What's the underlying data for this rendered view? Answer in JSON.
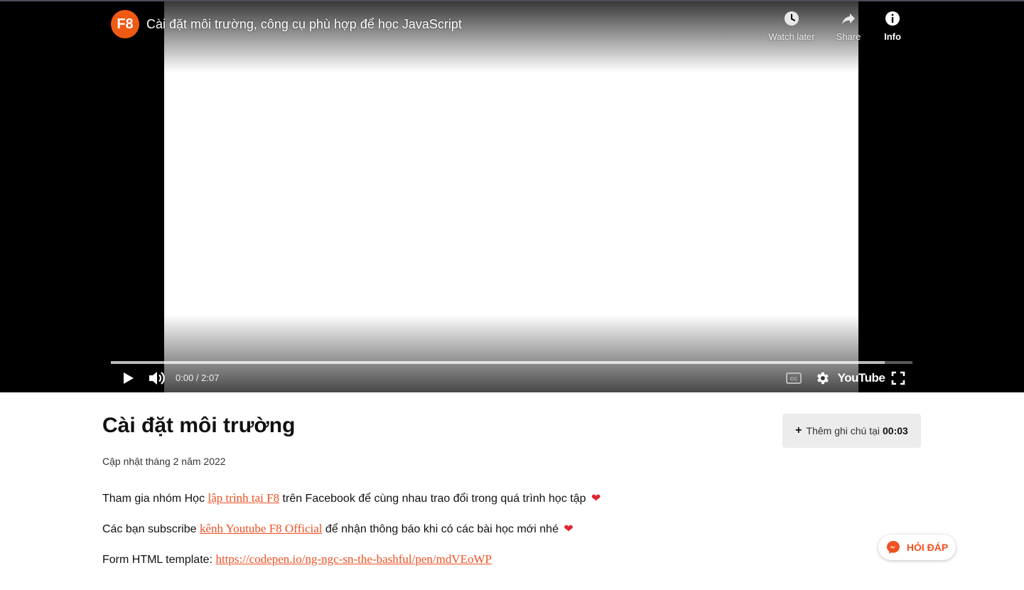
{
  "player": {
    "channel_logo_text": "F8",
    "video_title": "Cài đặt môi trường, công cụ phù hợp để học JavaScript",
    "watch_later_label": "Watch later",
    "share_label": "Share",
    "info_label": "Info",
    "time_display": "0:00 / 2:07",
    "progress_fraction": 0.965,
    "youtube_logo_text": "YouTube"
  },
  "lesson": {
    "title": "Cài đặt môi trường",
    "updated": "Cập nhật tháng 2 năm 2022",
    "add_note_label": "Thêm ghi chú tại",
    "add_note_time": "00:03"
  },
  "description": {
    "line1_prefix": "Tham gia nhóm Học ",
    "line1_link": "lập trình tại F8",
    "line1_suffix": " trên Facebook để cùng nhau trao đổi trong quá trình học tập ",
    "line2_prefix": "Các bạn subscribe ",
    "line2_link": "kênh Youtube F8 Official",
    "line2_suffix": " để nhận thông báo khi có các bài học mới nhé ",
    "line3_prefix": "Form HTML template: ",
    "line3_link": "https://codepen.io/ng-ngc-sn-the-bashful/pen/mdVEoWP",
    "heart": "❤"
  },
  "help_button": {
    "label": "HỎI ĐÁP"
  },
  "colors": {
    "accent": "#f05123",
    "heart": "#e2232f"
  },
  "icons": [
    "clock-icon",
    "share-icon",
    "info-icon",
    "play-icon",
    "volume-icon",
    "captions-icon",
    "settings-icon",
    "fullscreen-icon",
    "plus-icon",
    "messenger-icon"
  ]
}
